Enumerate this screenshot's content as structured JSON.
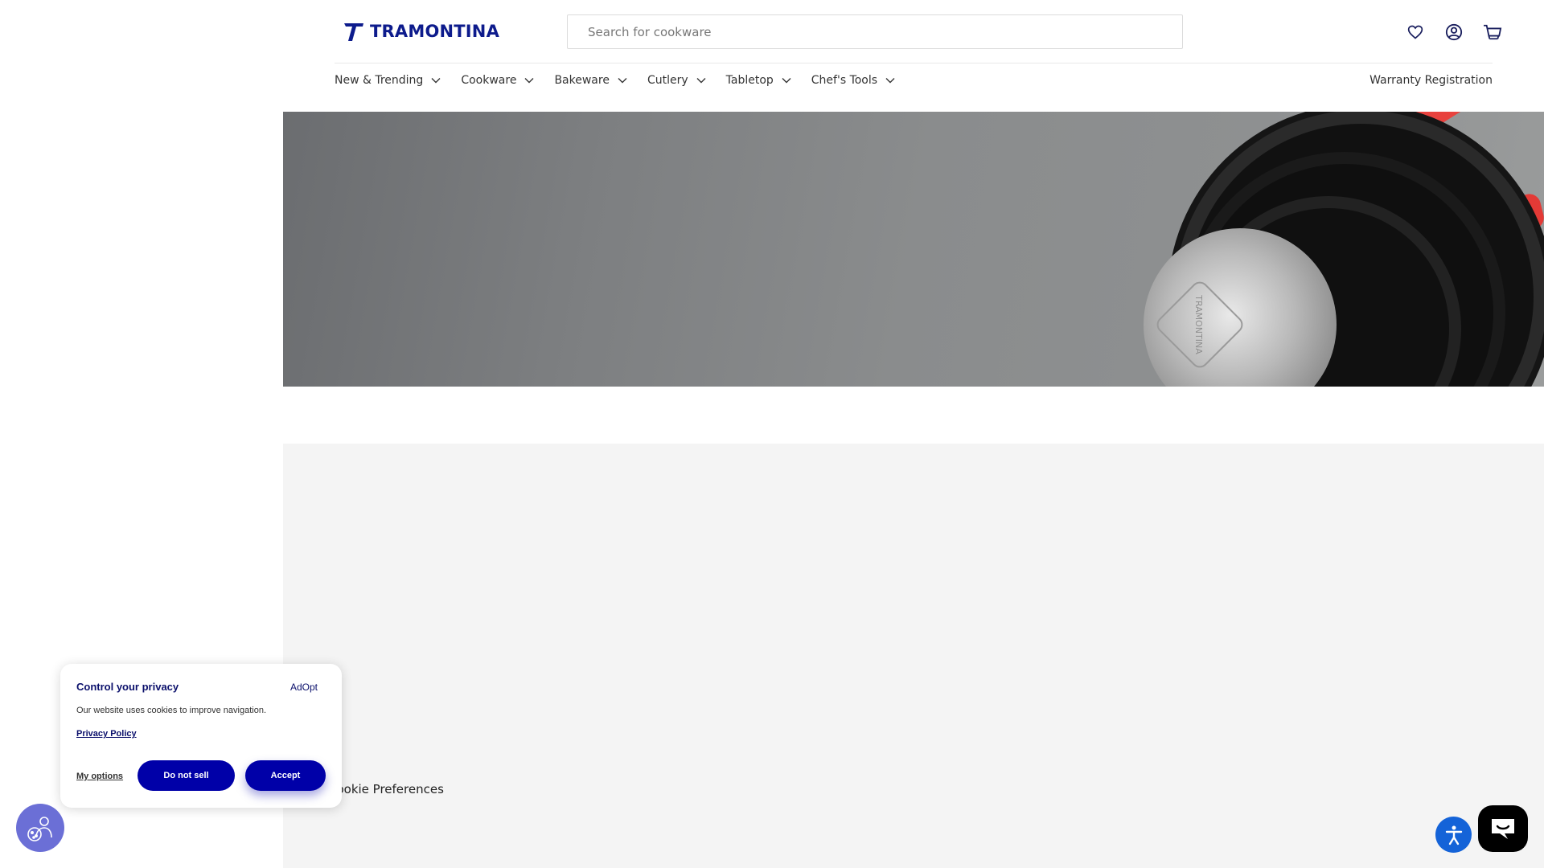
{
  "header": {
    "brand": "TRAMONTINA",
    "search_placeholder": "Search for cookware",
    "icons": [
      "heart-icon",
      "account-icon",
      "cart-icon"
    ],
    "brand_color": "#0d1b8c"
  },
  "nav": {
    "items": [
      {
        "label": "New & Trending"
      },
      {
        "label": "Cookware"
      },
      {
        "label": "Bakeware"
      },
      {
        "label": "Cutlery"
      },
      {
        "label": "Tabletop"
      },
      {
        "label": "Chef's Tools"
      }
    ],
    "warranty": "Warranty Registration"
  },
  "hero": {
    "image": "frying-pans-with-red-handles",
    "pan_stamp": "TRAMONTINA"
  },
  "footer": {
    "cookie_preferences": "Cookie Preferences"
  },
  "cookie_banner": {
    "title": "Control your privacy",
    "brand": "AdOpt",
    "text": "Our website uses cookies to improve navigation.",
    "privacy_link": "Privacy Policy",
    "my_options": "My options",
    "do_not_sell": "Do not sell",
    "accept": "Accept",
    "accent_color": "#0000a8"
  }
}
